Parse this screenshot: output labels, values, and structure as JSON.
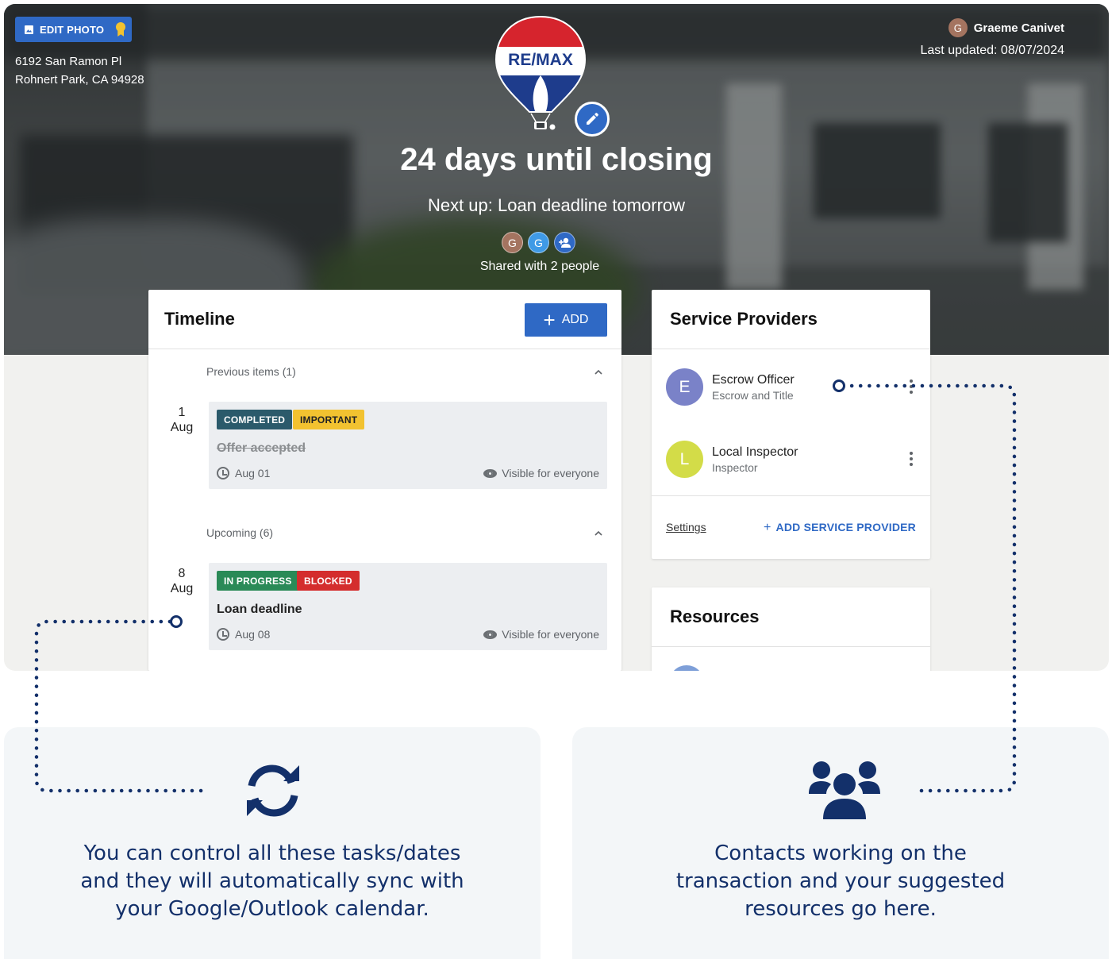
{
  "hero": {
    "edit_photo_label": "EDIT PHOTO",
    "address_line1": "6192 San Ramon Pl",
    "address_line2": "Rohnert Park, CA 94928",
    "user_initial": "G",
    "user_name": "Graeme Canivet",
    "last_updated": "Last updated: 08/07/2024",
    "logo_text": "RE/MAX",
    "countdown": "24 days until closing",
    "next_up": "Next up: Loan deadline tomorrow",
    "shared_avatars": [
      "G",
      "G"
    ],
    "shared_text": "Shared with 2 people"
  },
  "timeline": {
    "title": "Timeline",
    "add_label": "ADD",
    "sections": [
      {
        "label": "Previous items (1)",
        "events": [
          {
            "day": "1",
            "month": "Aug",
            "tags": [
              "COMPLETED",
              "IMPORTANT"
            ],
            "title": "Offer accepted",
            "date": "Aug 01",
            "visibility": "Visible for everyone"
          }
        ]
      },
      {
        "label": "Upcoming (6)",
        "events": [
          {
            "day": "8",
            "month": "Aug",
            "tags": [
              "IN PROGRESS",
              "BLOCKED"
            ],
            "title": "Loan deadline",
            "date": "Aug 08",
            "visibility": "Visible for everyone"
          }
        ]
      }
    ]
  },
  "service_providers": {
    "title": "Service Providers",
    "items": [
      {
        "initial": "E",
        "name": "Escrow Officer",
        "role": "Escrow and Title"
      },
      {
        "initial": "L",
        "name": "Local Inspector",
        "role": "Inspector"
      }
    ],
    "settings_label": "Settings",
    "add_label": "ADD SERVICE PROVIDER"
  },
  "resources": {
    "title": "Resources"
  },
  "info_cards": {
    "left_line1": "You can control all these tasks/dates",
    "left_line2": "and they will automatically sync with",
    "left_line3": "your Google/Outlook calendar.",
    "right_line1": "Contacts working on the",
    "right_line2": "transaction and your suggested",
    "right_line3": "resources go here."
  },
  "colors": {
    "primary": "#2f69c5",
    "completed": "#2b5a6b",
    "important": "#f2c230",
    "in_progress": "#2a8a57",
    "blocked": "#d42d2d",
    "escrow_avatar": "#7a82c8",
    "inspector_avatar": "#d3dc48",
    "navy_text": "#13306a"
  },
  "icons": [
    "image-icon",
    "award-icon",
    "pencil-icon",
    "add-person-icon",
    "chevron-up-icon",
    "clock-icon",
    "eye-icon",
    "more-vert-icon",
    "sync-icon",
    "people-icon"
  ]
}
